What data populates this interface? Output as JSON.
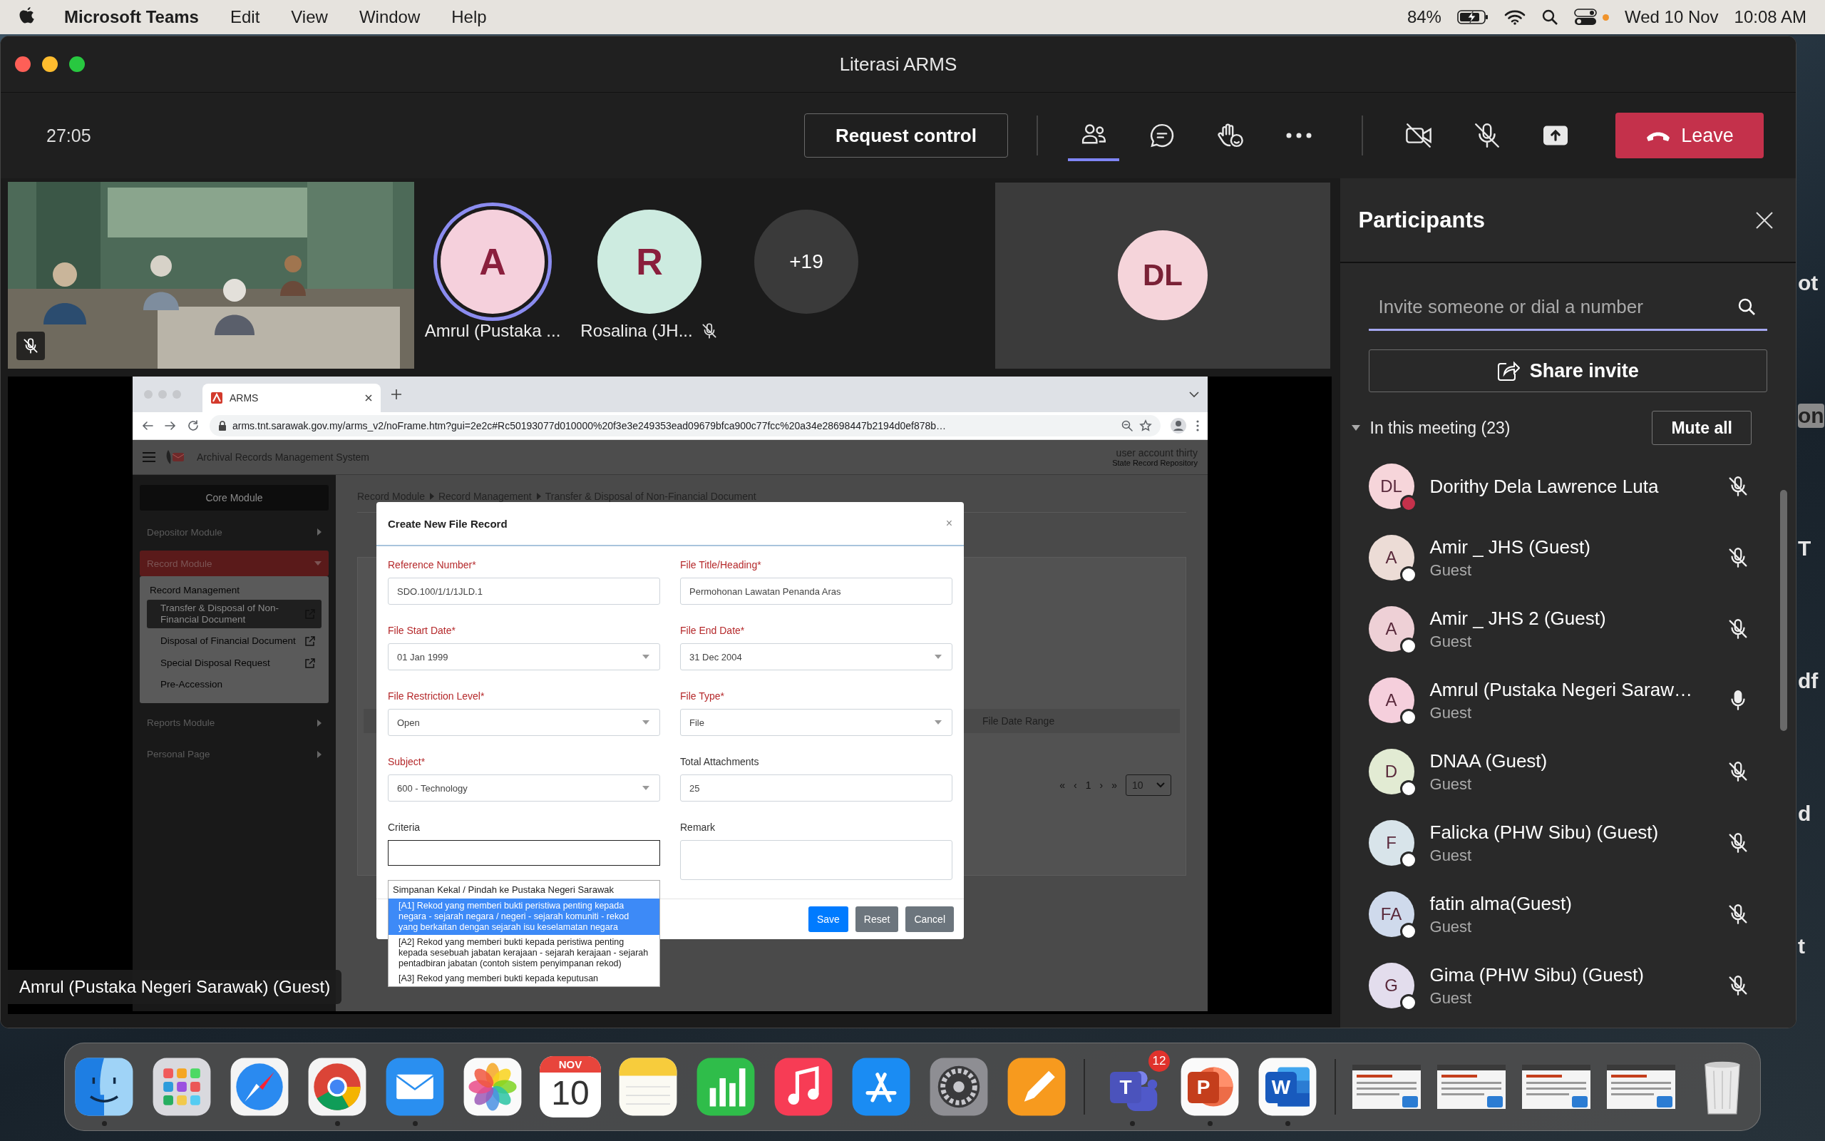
{
  "menu_bar": {
    "app": "Microsoft Teams",
    "menus": [
      "Edit",
      "View",
      "Window",
      "Help"
    ],
    "battery": "84%",
    "date": "Wed 10 Nov",
    "time": "10:08 AM"
  },
  "window": {
    "title": "Literasi ARMS"
  },
  "toolbar": {
    "timer": "27:05",
    "request_control": "Request control",
    "view_buttons": [
      {
        "kind": "people",
        "selected": true
      },
      {
        "kind": "chat",
        "selected": false
      },
      {
        "kind": "react",
        "selected": false
      },
      {
        "kind": "more",
        "selected": false
      }
    ],
    "device_buttons": [
      {
        "kind": "camera",
        "on": false
      },
      {
        "kind": "mic",
        "on": false
      },
      {
        "kind": "share"
      }
    ],
    "leave": "Leave"
  },
  "video_tile": {
    "kind": "picture",
    "muted": true
  },
  "avatars": [
    {
      "kind": "person",
      "initials": "A",
      "name": "Amrul (Pustaka ...",
      "color": "#f5d0dc",
      "speaking": true,
      "muted": false
    },
    {
      "kind": "person",
      "initials": "R",
      "name": "Rosalina (JH...",
      "color": "#cdebe0",
      "speaking": false,
      "muted": true
    },
    {
      "kind": "overflow",
      "initials": "+19",
      "color": "#3a3a3a"
    }
  ],
  "spotlight": {
    "initials": "DL",
    "color": "#f5d4da"
  },
  "shared_screen": {
    "presenter": "Amrul (Pustaka Negeri Sarawak) (Guest)",
    "browser": {
      "tab": "ARMS",
      "url": "arms.tnt.sarawak.gov.my/arms_v2/noFrame.htm?gui=2e2c#Rc50193077d010000%20f3e3e249353ead09679bfca900c77fcc%20a34e28698447b2194d0ef878b…"
    },
    "app": {
      "title": "Archival Records Management System",
      "user": "user account thirty",
      "role": "State Record Repository"
    },
    "sidebar": {
      "core": "Core Module",
      "modules": [
        {
          "label": "Depositor Module",
          "selected": false,
          "expanded": false
        },
        {
          "label": "Record Module",
          "selected": true,
          "expanded": true,
          "section": "Record Management",
          "children": [
            {
              "label": "Transfer & Disposal of Non-Financial Document",
              "selected": true,
              "external": true
            },
            {
              "label": "Disposal of Financial Document",
              "selected": false,
              "external": true
            },
            {
              "label": "Special Disposal Request",
              "selected": false,
              "external": true
            },
            {
              "label": "Pre-Accession",
              "selected": false,
              "external": false
            }
          ]
        },
        {
          "label": "Reports Module",
          "selected": false,
          "expanded": false
        },
        {
          "label": "Personal Page",
          "selected": false,
          "expanded": false
        }
      ]
    },
    "breadcrumb": [
      "Record Module",
      "Record Management",
      "Transfer & Disposal of Non-Financial Document"
    ],
    "table": {
      "column": "File Date Range",
      "pager": [
        "«",
        "‹",
        "1",
        "›",
        "»"
      ],
      "page_size": "10"
    },
    "modal": {
      "title": "Create New File Record",
      "close": "×",
      "fields": [
        {
          "label": "Reference Number*",
          "required": true,
          "kind": "text",
          "value": "SDO.100/1/1/1JLD.1"
        },
        {
          "label": "File Title/Heading*",
          "required": true,
          "kind": "text",
          "value": "Permohonan Lawatan Penanda Aras"
        },
        {
          "label": "File Start Date*",
          "required": true,
          "kind": "select",
          "value": "01 Jan 1999"
        },
        {
          "label": "File End Date*",
          "required": true,
          "kind": "select",
          "value": "31 Dec 2004"
        },
        {
          "label": "File Restriction Level*",
          "required": true,
          "kind": "select",
          "value": "Open"
        },
        {
          "label": "File Type*",
          "required": true,
          "kind": "select",
          "value": "File"
        },
        {
          "label": "Subject*",
          "required": true,
          "kind": "select",
          "value": "600 - Technology"
        },
        {
          "label": "Total Attachments",
          "required": false,
          "kind": "text",
          "value": "25"
        },
        {
          "label": "Criteria",
          "required": false,
          "kind": "combo",
          "dropdown": {
            "group": "Simpanan Kekal / Pindah ke Pustaka Negeri Sarawak",
            "options": [
              {
                "text": "[A1] Rekod yang memberi bukti peristiwa penting kepada negara - sejarah negara / negeri - sejarah komuniti - rekod yang berkaitan dengan sejarah isu keselamatan negara",
                "selected": true
              },
              {
                "text": "[A2] Rekod yang memberi bukti kepada peristiwa penting kepada sesebuah jabatan kerajaan - sejarah kerajaan - sejarah pentadbiran jabatan (contoh sistem penyimpanan rekod)",
                "selected": false
              },
              {
                "text": "[A3] Rekod yang memberi bukti kepada keputusan",
                "selected": false
              }
            ]
          }
        },
        {
          "label": "Remark",
          "required": false,
          "kind": "textarea"
        }
      ],
      "buttons": [
        {
          "label": "Save",
          "kind": "primary"
        },
        {
          "label": "Reset",
          "kind": "secondary"
        },
        {
          "label": "Cancel",
          "kind": "secondary"
        }
      ]
    }
  },
  "participants": {
    "title": "Participants",
    "search_placeholder": "Invite someone or dial a number",
    "share_invite": "Share invite",
    "section": "In this meeting (23)",
    "expanded": true,
    "mute_all": "Mute all",
    "items": [
      {
        "initials": "DL",
        "name": "Dorithy Dela Lawrence Luta",
        "color": "#f6d5da",
        "busy": true,
        "muted": true
      },
      {
        "initials": "A",
        "name": "Amir _ JHS (Guest)",
        "role": "Guest",
        "color": "#ecdcd6",
        "busy": false,
        "muted": true
      },
      {
        "initials": "A",
        "name": "Amir _ JHS 2 (Guest)",
        "role": "Guest",
        "color": "#eed0d6",
        "busy": false,
        "muted": true
      },
      {
        "initials": "A",
        "name": "Amrul (Pustaka Negeri Saraw…",
        "role": "Guest",
        "color": "#f5cfdc",
        "busy": false,
        "muted": false
      },
      {
        "initials": "D",
        "name": "DNAA (Guest)",
        "role": "Guest",
        "color": "#e2ebd3",
        "busy": false,
        "muted": true
      },
      {
        "initials": "F",
        "name": "Falicka (PHW Sibu) (Guest)",
        "role": "Guest",
        "color": "#d8e4ea",
        "busy": false,
        "muted": true
      },
      {
        "initials": "FA",
        "name": "fatin alma(Guest)",
        "role": "Guest",
        "color": "#cfdaec",
        "busy": false,
        "muted": true
      },
      {
        "initials": "G",
        "name": "Gima (PHW Sibu) (Guest)",
        "role": "Guest",
        "color": "#e3dded",
        "busy": false,
        "muted": true
      }
    ]
  },
  "desktop_fragments": [
    "ot",
    "on",
    "T",
    "df",
    "d",
    "t"
  ],
  "dock": [
    {
      "kind": "finder",
      "running": true
    },
    {
      "kind": "launchpad",
      "running": false
    },
    {
      "kind": "safari",
      "running": false
    },
    {
      "kind": "chrome",
      "running": true
    },
    {
      "kind": "mail",
      "running": true
    },
    {
      "kind": "photos",
      "running": false
    },
    {
      "kind": "calendar",
      "running": false,
      "month": "NOV",
      "day": "10"
    },
    {
      "kind": "notes",
      "running": false
    },
    {
      "kind": "numbers",
      "running": false
    },
    {
      "kind": "music",
      "running": false
    },
    {
      "kind": "appstore",
      "running": false
    },
    {
      "kind": "settings",
      "running": false
    },
    {
      "kind": "pages",
      "running": false
    },
    {
      "kind": "separator"
    },
    {
      "kind": "teams",
      "running": true,
      "letter": "T",
      "badge": "12"
    },
    {
      "kind": "powerpoint",
      "running": true,
      "letter": "P"
    },
    {
      "kind": "word",
      "running": true,
      "letter": "W"
    },
    {
      "kind": "separator"
    },
    {
      "kind": "window"
    },
    {
      "kind": "window"
    },
    {
      "kind": "window"
    },
    {
      "kind": "window"
    },
    {
      "kind": "trash"
    }
  ]
}
